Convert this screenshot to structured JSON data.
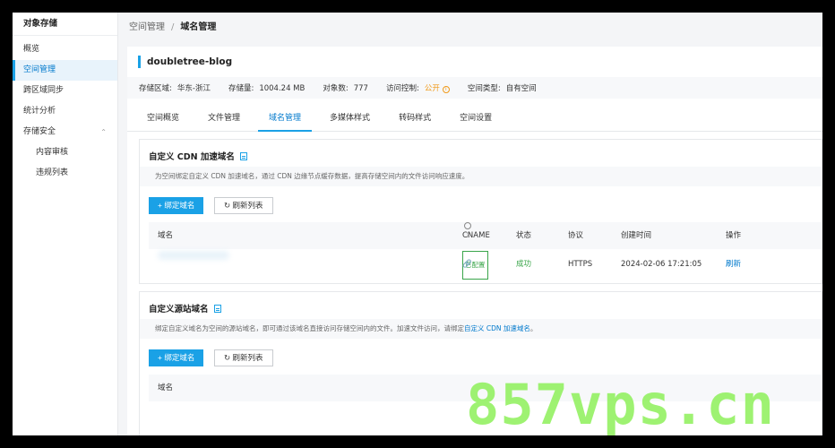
{
  "sidebar": {
    "title": "对象存储",
    "items": [
      {
        "label": "概览"
      },
      {
        "label": "空间管理"
      },
      {
        "label": "跨区域同步"
      },
      {
        "label": "统计分析"
      },
      {
        "label": "存储安全"
      },
      {
        "label": "内容审核"
      },
      {
        "label": "违规列表"
      }
    ]
  },
  "breadcrumb": {
    "parent": "空间管理",
    "separator": "/",
    "current": "域名管理"
  },
  "bucket": {
    "name": "doubletree-blog",
    "region_label": "存储区域:",
    "region": "华东-浙江",
    "size_label": "存储量:",
    "size": "1004.24 MB",
    "count_label": "对象数:",
    "count": "777",
    "access_label": "访问控制:",
    "access": "公开",
    "type_label": "空间类型:",
    "type": "自有空间"
  },
  "tabs": [
    {
      "label": "空间概览"
    },
    {
      "label": "文件管理"
    },
    {
      "label": "域名管理"
    },
    {
      "label": "多媒体样式"
    },
    {
      "label": "转码样式"
    },
    {
      "label": "空间设置"
    }
  ],
  "cdn": {
    "title": "自定义 CDN 加速域名",
    "desc": "为空间绑定自定义 CDN 加速域名，通过 CDN 边缘节点缓存数据，提高存储空间内的文件访问响应速度。",
    "bind_button": "+ 绑定域名",
    "refresh_button": "刷新列表",
    "columns": {
      "domain": "域名",
      "cname": "CNAME",
      "status": "状态",
      "protocol": "协议",
      "created": "创建时间",
      "action": "操作"
    },
    "rows": [
      {
        "cname": "已配置",
        "status": "成功",
        "protocol": "HTTPS",
        "created": "2024-02-06 17:21:05",
        "action": "刷新"
      }
    ]
  },
  "origin": {
    "title": "自定义源站域名",
    "desc_prefix": "绑定自定义域名为空间的源站域名，即可通过该域名直接访问存储空间内的文件。加速文件访问，请绑定",
    "desc_link": "自定义 CDN 加速域名",
    "desc_suffix": "。",
    "bind_button": "+ 绑定域名",
    "refresh_button": "刷新列表",
    "columns": {
      "domain": "域名"
    }
  },
  "watermark": "857vps.cn"
}
